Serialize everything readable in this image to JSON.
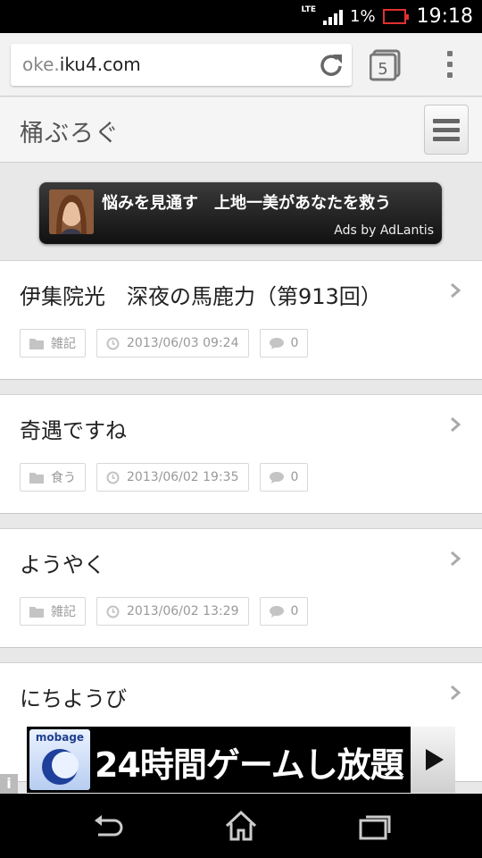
{
  "status_bar": {
    "network": "LTE",
    "battery_percent": "1%",
    "time": "19:18",
    "battery_color": "#e03030"
  },
  "browser": {
    "url_prefix": "oke.",
    "url_domain": "iku4.com",
    "tab_count": "5",
    "icons": [
      "reload-icon",
      "tabs-icon",
      "overflow-menu-icon"
    ]
  },
  "site": {
    "title": "桶ぶろぐ",
    "menu_icon": "hamburger-icon"
  },
  "ad_top": {
    "text": "悩みを見通す　上地一美があなたを救う",
    "attribution": "Ads by AdLantis"
  },
  "posts": [
    {
      "title": "伊集院光　深夜の馬鹿力（第913回）",
      "category": "雑記",
      "datetime": "2013/06/03 09:24",
      "comments": "0"
    },
    {
      "title": "奇遇ですね",
      "category": "食う",
      "datetime": "2013/06/02 19:35",
      "comments": "0"
    },
    {
      "title": "ようやく",
      "category": "雑記",
      "datetime": "2013/06/02 13:29",
      "comments": "0"
    },
    {
      "title": "にちようび"
    }
  ],
  "ad_bottom": {
    "brand": "mobage",
    "text": "24時間ゲームし放題",
    "info": "i"
  },
  "nav_bar": {
    "icons": [
      "back-icon",
      "home-icon",
      "recent-apps-icon"
    ]
  },
  "colors": {
    "page_background": "#e8e8e8",
    "title_text": "#222222",
    "meta_text": "#999999"
  }
}
